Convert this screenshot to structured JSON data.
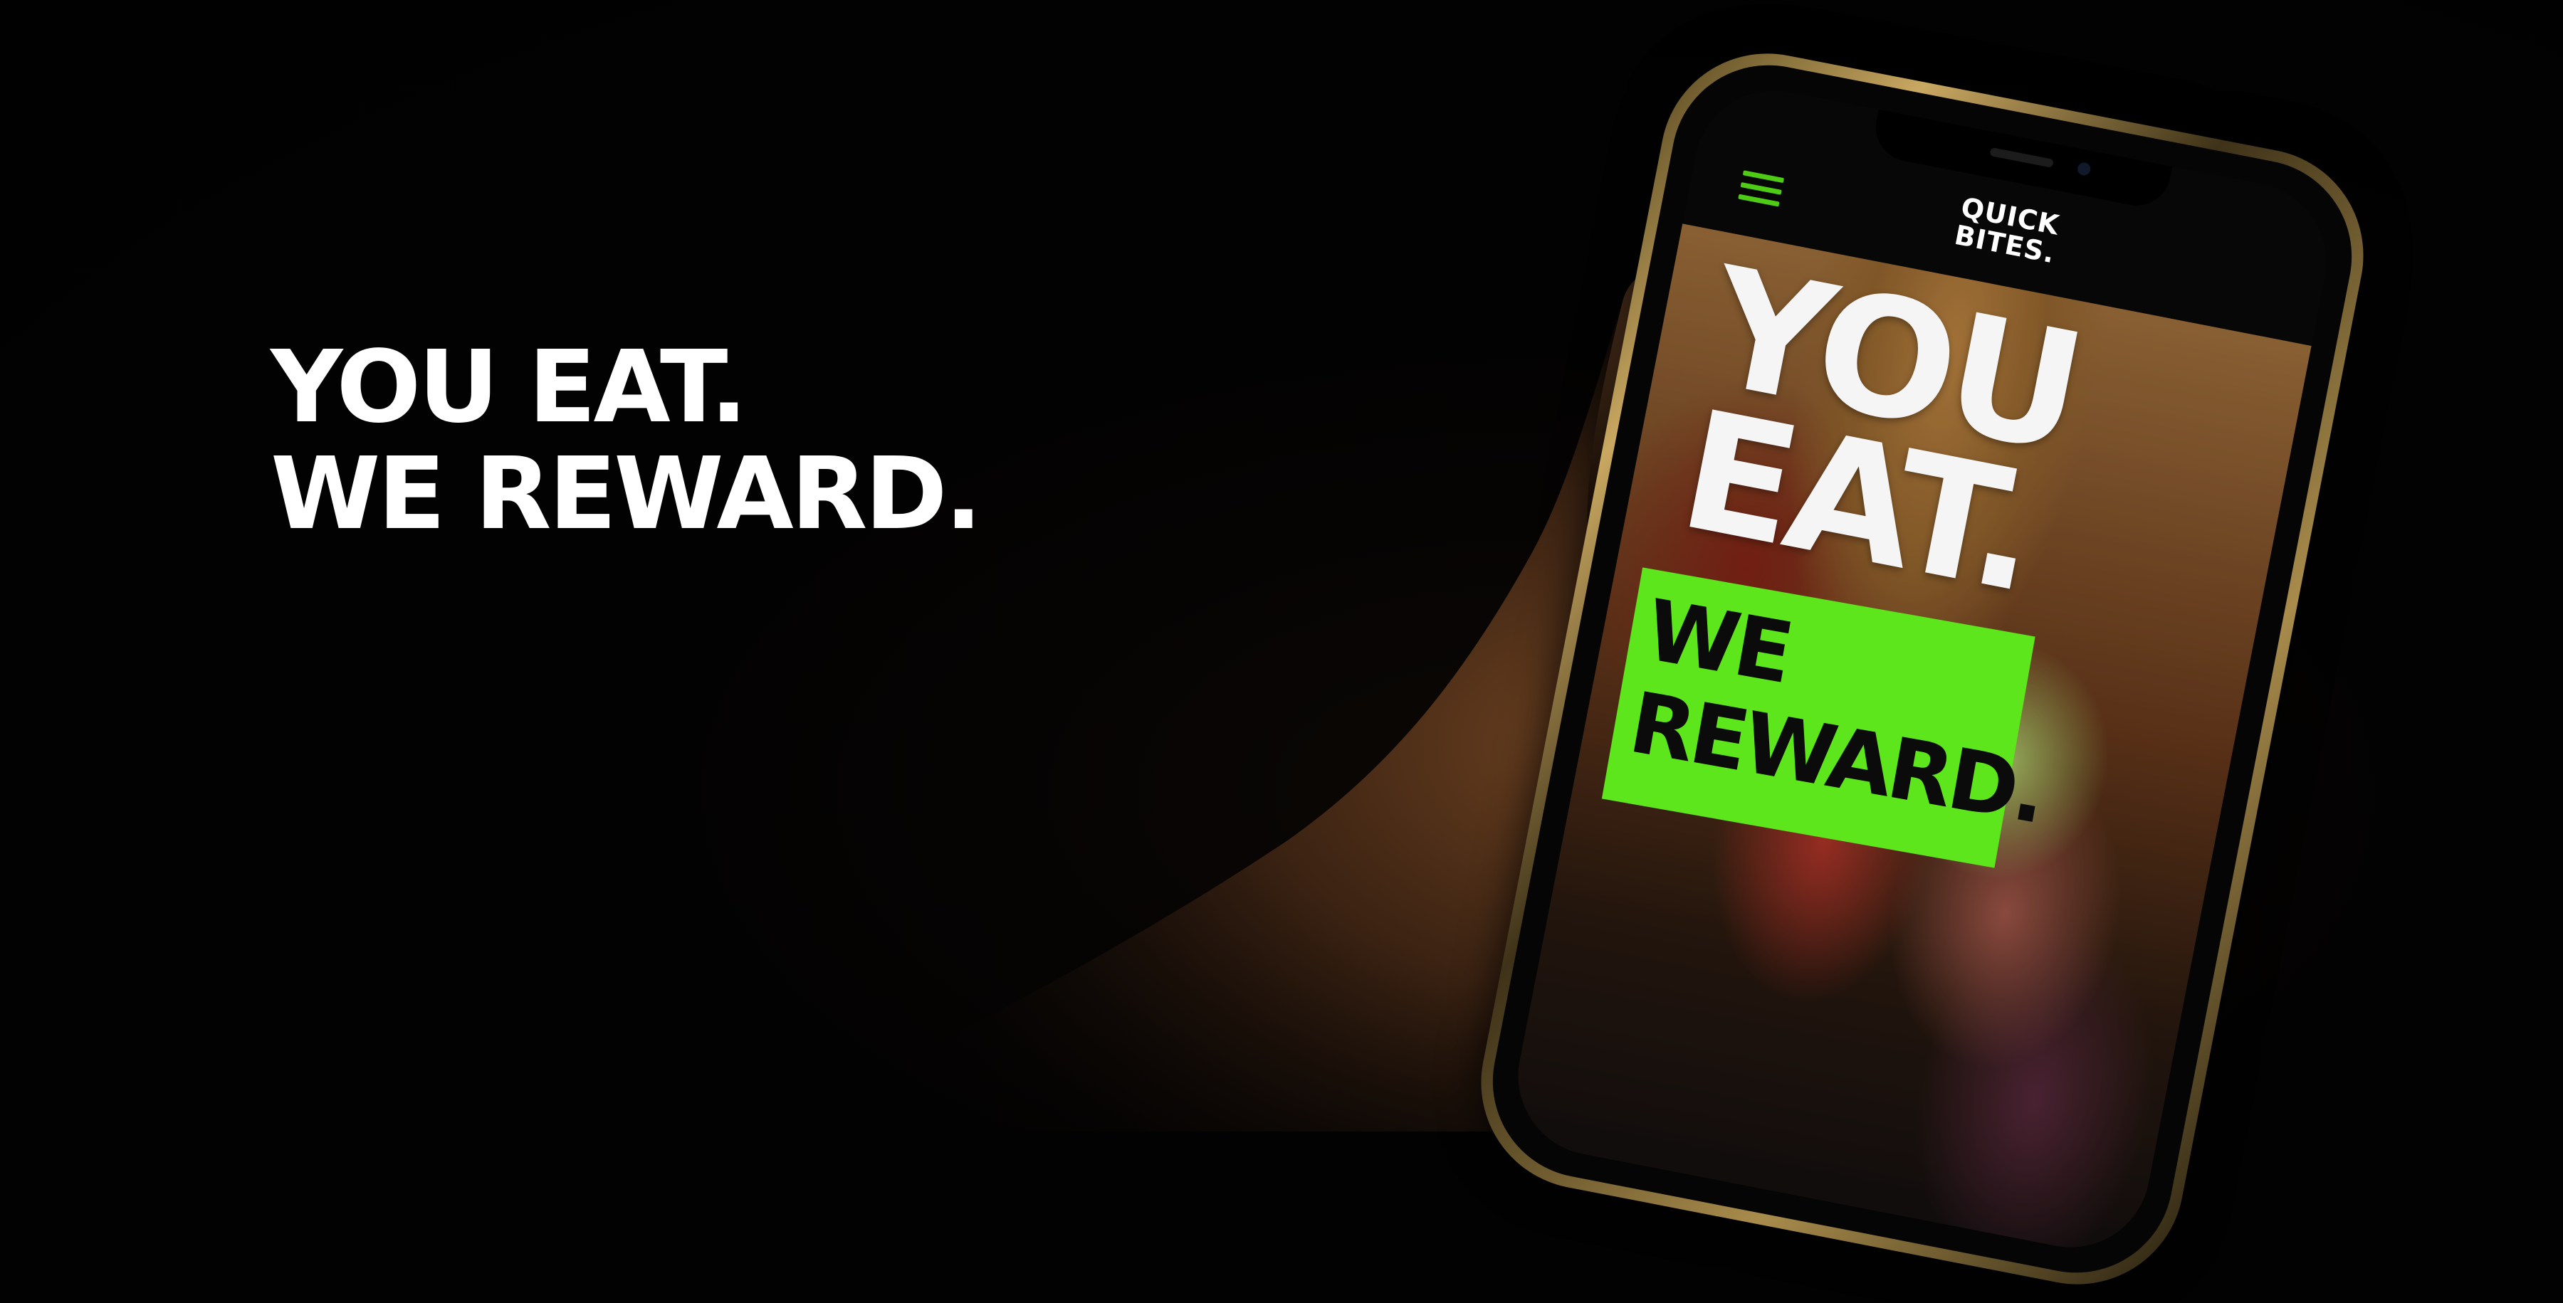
{
  "hero": {
    "headline_line1": "YOU EAT.",
    "headline_line2": "WE REWARD."
  },
  "phone_app": {
    "logo_line1": "QUICK",
    "logo_line2": "BITES.",
    "menu_icon": "hamburger-menu-icon",
    "screen_headline_line1": "YOU",
    "screen_headline_line2": "EAT.",
    "reward_line1": "WE",
    "reward_line2": "REWARD."
  },
  "colors": {
    "background": "#020202",
    "accent_green": "#5ee61c",
    "headline_white": "#ffffff",
    "phone_gold": "#c9a861"
  }
}
